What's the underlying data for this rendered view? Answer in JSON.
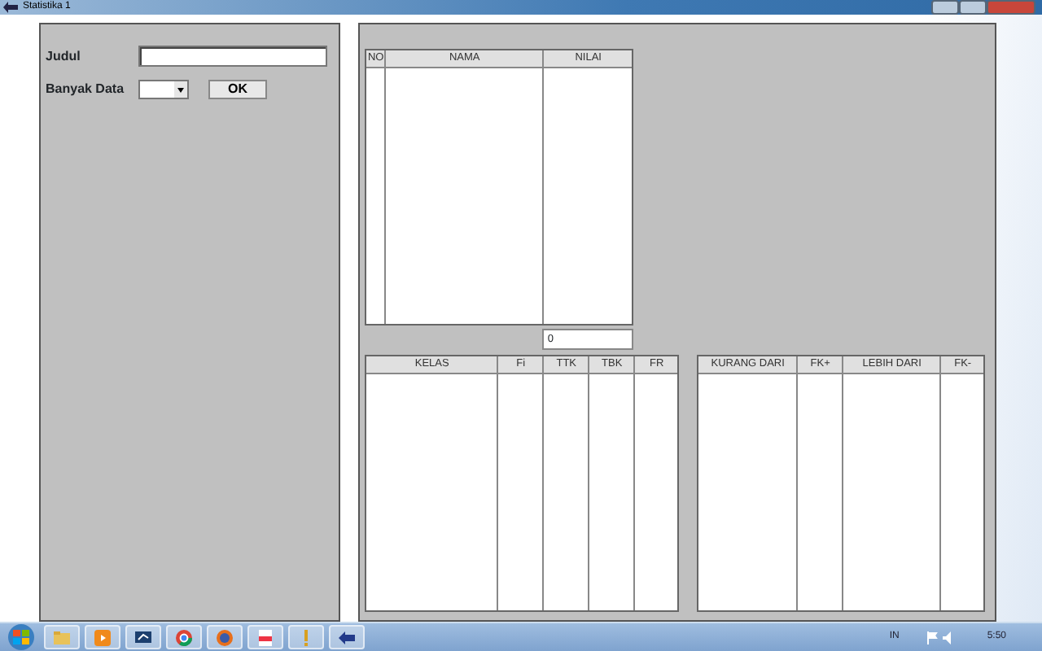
{
  "window": {
    "title": "Statistika 1"
  },
  "form": {
    "judul_label": "Judul",
    "banyak_data_label": "Banyak Data",
    "ok_button": "OK"
  },
  "data_table": {
    "columns": [
      "NO",
      "NAMA",
      "NILAI"
    ],
    "total": "0"
  },
  "frequency_table": {
    "columns": [
      "KELAS",
      "Fi",
      "TTK",
      "TBK",
      "FR"
    ]
  },
  "cumulative_table": {
    "columns": [
      "KURANG DARI",
      "FK+",
      "LEBIH DARI",
      "FK-"
    ]
  },
  "taskbar": {
    "language": "IN",
    "clock": "5:50"
  }
}
